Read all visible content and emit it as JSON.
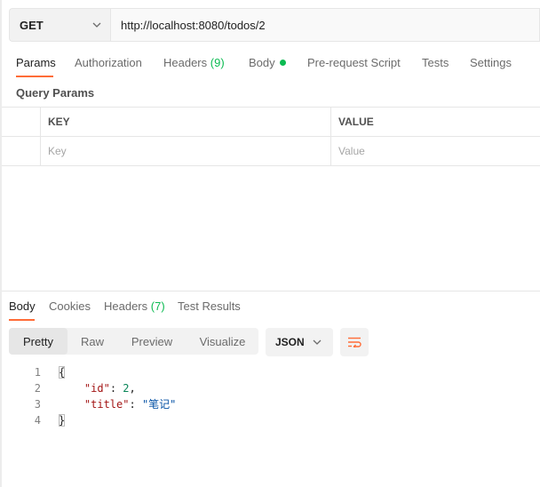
{
  "request": {
    "method": "GET",
    "url": "http://localhost:8080/todos/2"
  },
  "request_tabs": {
    "params": "Params",
    "authorization": "Authorization",
    "headers": "Headers",
    "headers_count": "(9)",
    "body": "Body",
    "pre_request": "Pre-request Script",
    "tests": "Tests",
    "settings": "Settings"
  },
  "query_params": {
    "title": "Query Params",
    "key_header": "KEY",
    "value_header": "VALUE",
    "key_placeholder": "Key",
    "value_placeholder": "Value"
  },
  "response_tabs": {
    "body": "Body",
    "cookies": "Cookies",
    "headers": "Headers",
    "headers_count": "(7)",
    "test_results": "Test Results"
  },
  "view_modes": {
    "pretty": "Pretty",
    "raw": "Raw",
    "preview": "Preview",
    "visualize": "Visualize"
  },
  "format": "JSON",
  "response_body": {
    "line_numbers": [
      "1",
      "2",
      "3",
      "4"
    ],
    "open_brace": "{",
    "close_brace": "}",
    "id_key": "\"id\"",
    "id_value": "2",
    "title_key": "\"title\"",
    "title_value": "\"笔记\""
  },
  "colors": {
    "accent": "#ff6c37",
    "count_green": "#0cbb52"
  },
  "icons": {
    "method_dropdown": "chevron-down-icon",
    "format_dropdown": "chevron-down-icon",
    "wrap": "wrap-lines-icon"
  }
}
